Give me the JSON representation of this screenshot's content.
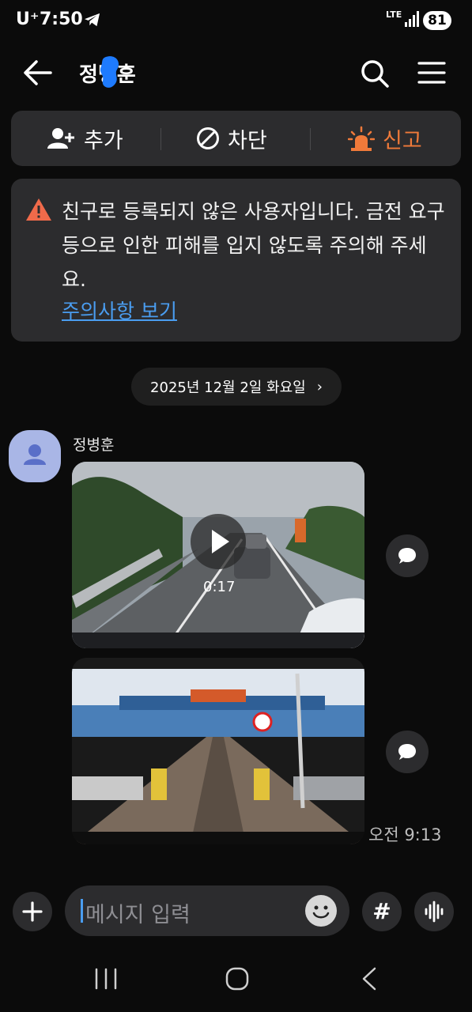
{
  "status_bar": {
    "carrier": "U⁺",
    "time": "7:50",
    "network": "LTE",
    "battery": "81"
  },
  "header": {
    "title": "정병훈"
  },
  "actions": {
    "add": "추가",
    "block": "차단",
    "report": "신고"
  },
  "warning": {
    "text": "친구로 등록되지 않은 사용자입니다. 금전 요구 등으로 인한 피해를 입지 않도록 주의해 주세요.",
    "link": "주의사항 보기"
  },
  "date_divider": "2025년 12월 2일 화요일",
  "message": {
    "sender": "정병훈",
    "video_duration": "0:17",
    "time": "오전 9:13"
  },
  "input": {
    "placeholder": "메시지 입력",
    "hash": "#"
  },
  "colors": {
    "report_accent": "#f07a3a",
    "link": "#4a9df0",
    "warning_icon": "#f06a4a"
  }
}
